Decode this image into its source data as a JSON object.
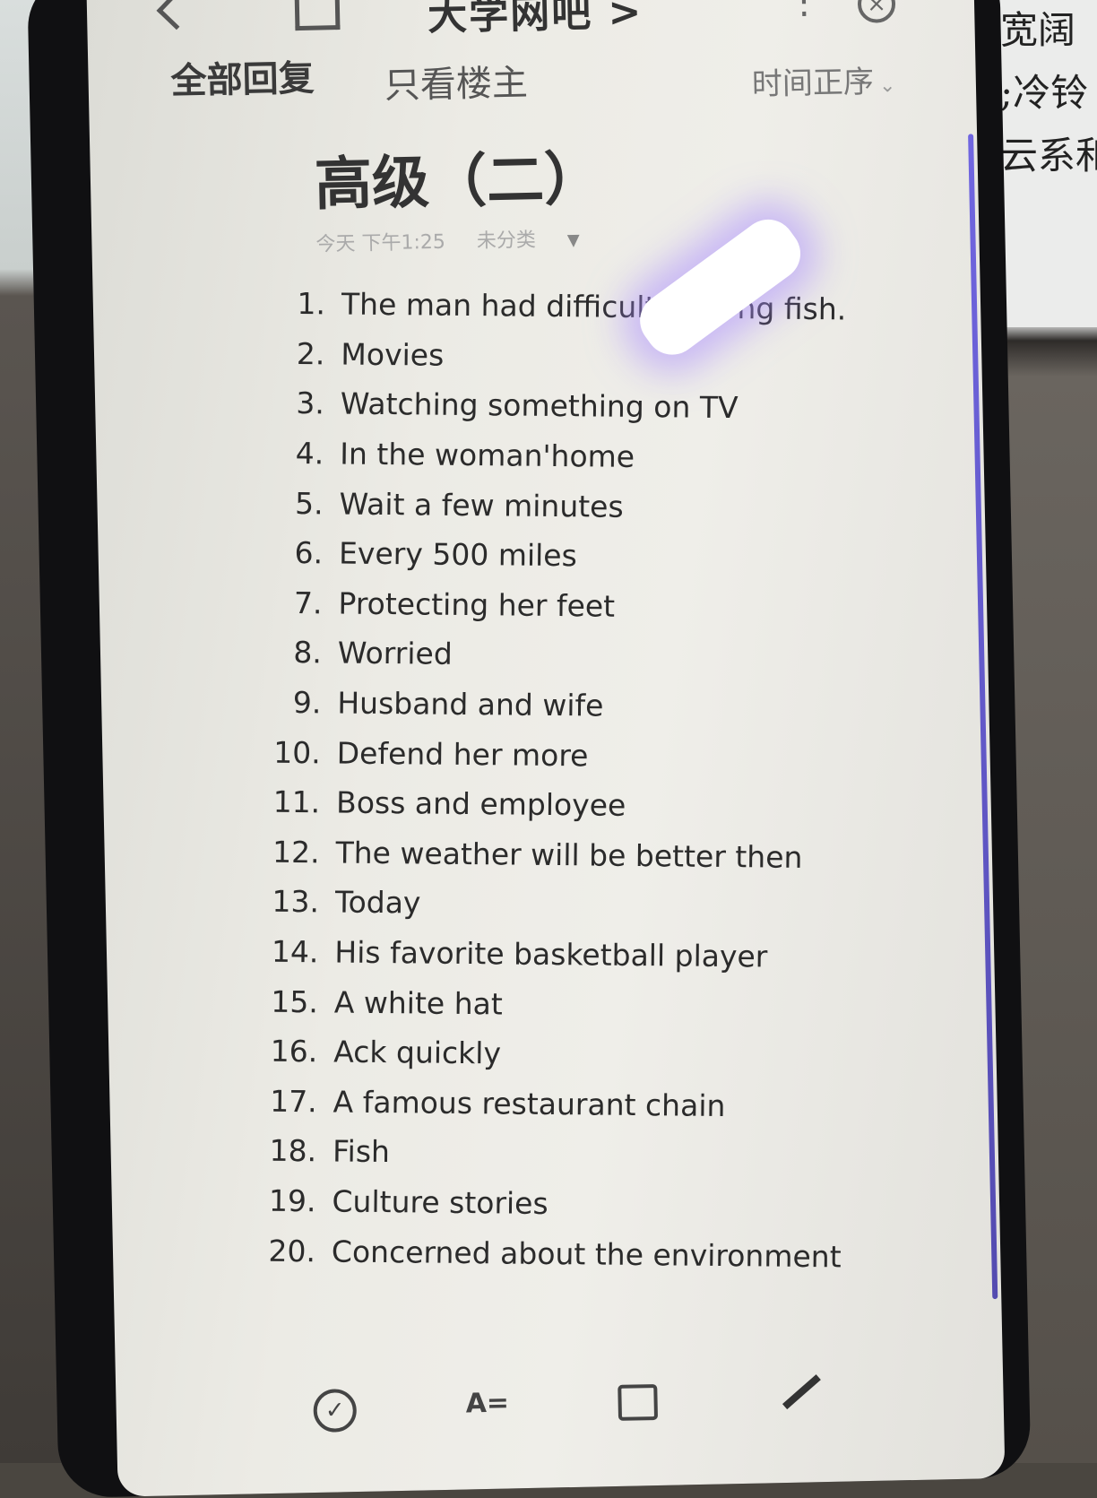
{
  "topbar": {
    "forum_title": "大学网吧 >",
    "more": "⋮",
    "close": "×"
  },
  "tabs": [
    {
      "label": "全部回复"
    },
    {
      "label": "只看楼主"
    }
  ],
  "sort_label": "时间正序",
  "post": {
    "title": "高级（二）",
    "time": "今天 下午1:25",
    "category": "未分类"
  },
  "answers": [
    {
      "num": "1.",
      "text": "The man had difficulty c... ng fish."
    },
    {
      "num": "2.",
      "text": "Movies"
    },
    {
      "num": "3.",
      "text": "Watching something on TV"
    },
    {
      "num": "4.",
      "text": "In the woman'home"
    },
    {
      "num": "5.",
      "text": "Wait a few minutes"
    },
    {
      "num": "6.",
      "text": "Every 500 miles"
    },
    {
      "num": "7.",
      "text": "Protecting her feet"
    },
    {
      "num": "8.",
      "text": "Worried"
    },
    {
      "num": "9.",
      "text": "Husband and wife"
    },
    {
      "num": "10.",
      "text": "Defend her more"
    },
    {
      "num": "11.",
      "text": "Boss and employee"
    },
    {
      "num": "12.",
      "text": "The weather will be better then"
    },
    {
      "num": "13.",
      "text": "Today"
    },
    {
      "num": "14.",
      "text": "His favorite basketball player"
    },
    {
      "num": "15.",
      "text": "A white hat"
    },
    {
      "num": "16.",
      "text": "Ack quickly"
    },
    {
      "num": "17.",
      "text": "A famous restaurant chain"
    },
    {
      "num": "18.",
      "text": "Fish"
    },
    {
      "num": "19.",
      "text": "Culture stories"
    },
    {
      "num": "20.",
      "text": "Concerned about the environment"
    }
  ],
  "bottom_bar": {
    "check": "✓",
    "format": "A="
  },
  "background_paper": [
    "宽阔",
    ";冷铃",
    "云系和"
  ],
  "colors": {
    "screen_bg": "#ecebe5",
    "text": "#2b2b2b",
    "glare": "#7a5cff"
  }
}
